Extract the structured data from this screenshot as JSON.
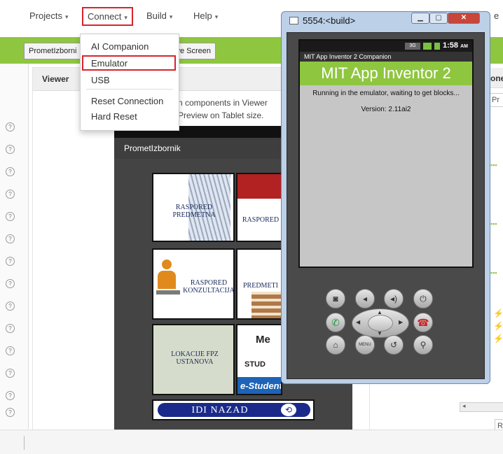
{
  "menubar": {
    "projects": "Projects",
    "connect": "Connect",
    "build": "Build",
    "help": "Help"
  },
  "toolbar": {
    "screen_select": "PrometIzborni",
    "remove_screen": "Remove Screen"
  },
  "viewer": {
    "title": "Viewer",
    "hint1": "n components in Viewer",
    "hint2": "Preview on Tablet size.",
    "screen_title": "PrometIzbornik"
  },
  "tiles": {
    "raspored_predmeta": "RASPORED PREDMETNA",
    "raspored": "RASPORED",
    "raspored_konzultacija": "RASPORED KONZULTACIJA",
    "predmeti": "PREDMETI",
    "lokacije": "LOKACIJE FPZ USTANOVA",
    "me": "Me",
    "stud": "STUD",
    "estudent": "e-Student",
    "idi_nazad": "IDI NAZAD"
  },
  "connect_menu": {
    "items": [
      "AI Companion",
      "Emulator",
      "USB",
      "Reset Connection",
      "Hard Reset"
    ],
    "selected": "Emulator"
  },
  "emulator": {
    "window_title": "5554:<build>",
    "clock": "1:58",
    "clock_suffix": "AM",
    "companion_title": "MIT App Inventor 2 Companion",
    "app_header": "MIT App Inventor 2",
    "message": "Running in the emulator, waiting to get blocks...",
    "version": "Version: 2.11ai2",
    "menu_button": "MENU"
  },
  "right_panel": {
    "header_fragment": "one",
    "tab_fragment": "Pr",
    "bottom_fragment": "R"
  },
  "window_edge_letter": "e",
  "colors": {
    "accent_green": "#8fc640",
    "highlight_red": "#d9232d",
    "emulator_frame": "#4a4a4a"
  }
}
